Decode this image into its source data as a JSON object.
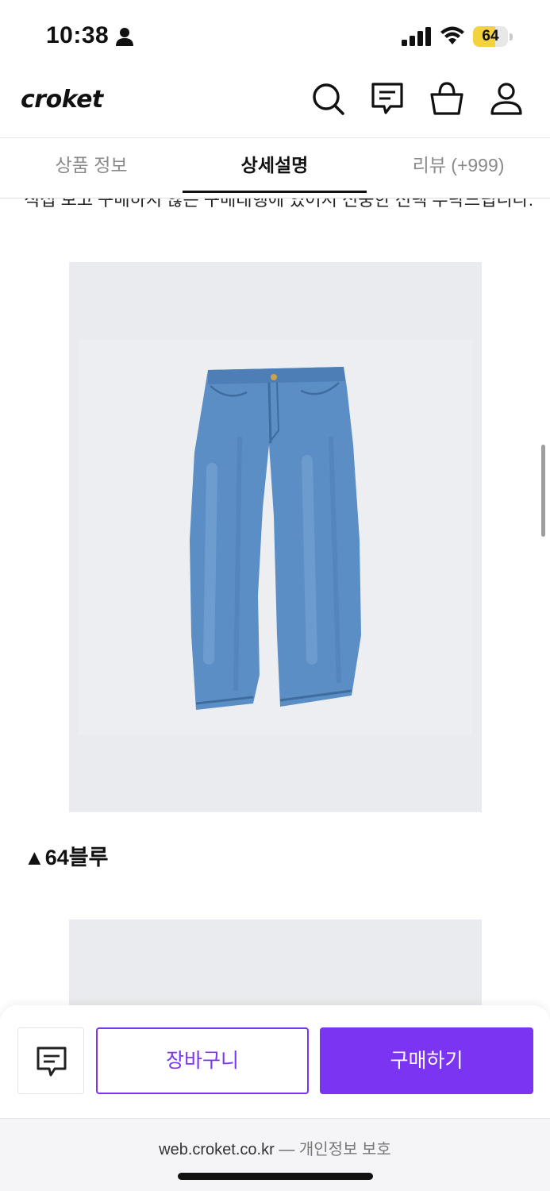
{
  "status_bar": {
    "time": "10:38",
    "battery_level": "64",
    "battery_percent": 64
  },
  "header": {
    "logo": "croket",
    "icons": [
      "search-icon",
      "chat-icon",
      "basket-icon",
      "user-icon"
    ]
  },
  "tabs": [
    {
      "label": "상품 정보",
      "active": false
    },
    {
      "label": "상세설명",
      "active": true
    },
    {
      "label": "리뷰 (+999)",
      "active": false
    }
  ],
  "content": {
    "cut_text": "직접 보고 구매하지 않은 구매대행에 있어서 신중한 선택 부탁드립니다.",
    "caption": "▲64블루"
  },
  "actions": {
    "chat_icon": "chat-icon",
    "cart_label": "장바구니",
    "buy_label": "구매하기"
  },
  "browser": {
    "url": "web.croket.co.kr",
    "separator": "—",
    "privacy": "개인정보 보호"
  },
  "colors": {
    "accent": "#7b34f2",
    "image_bg": "#e9ebee",
    "denim": "#5b8ec4"
  }
}
